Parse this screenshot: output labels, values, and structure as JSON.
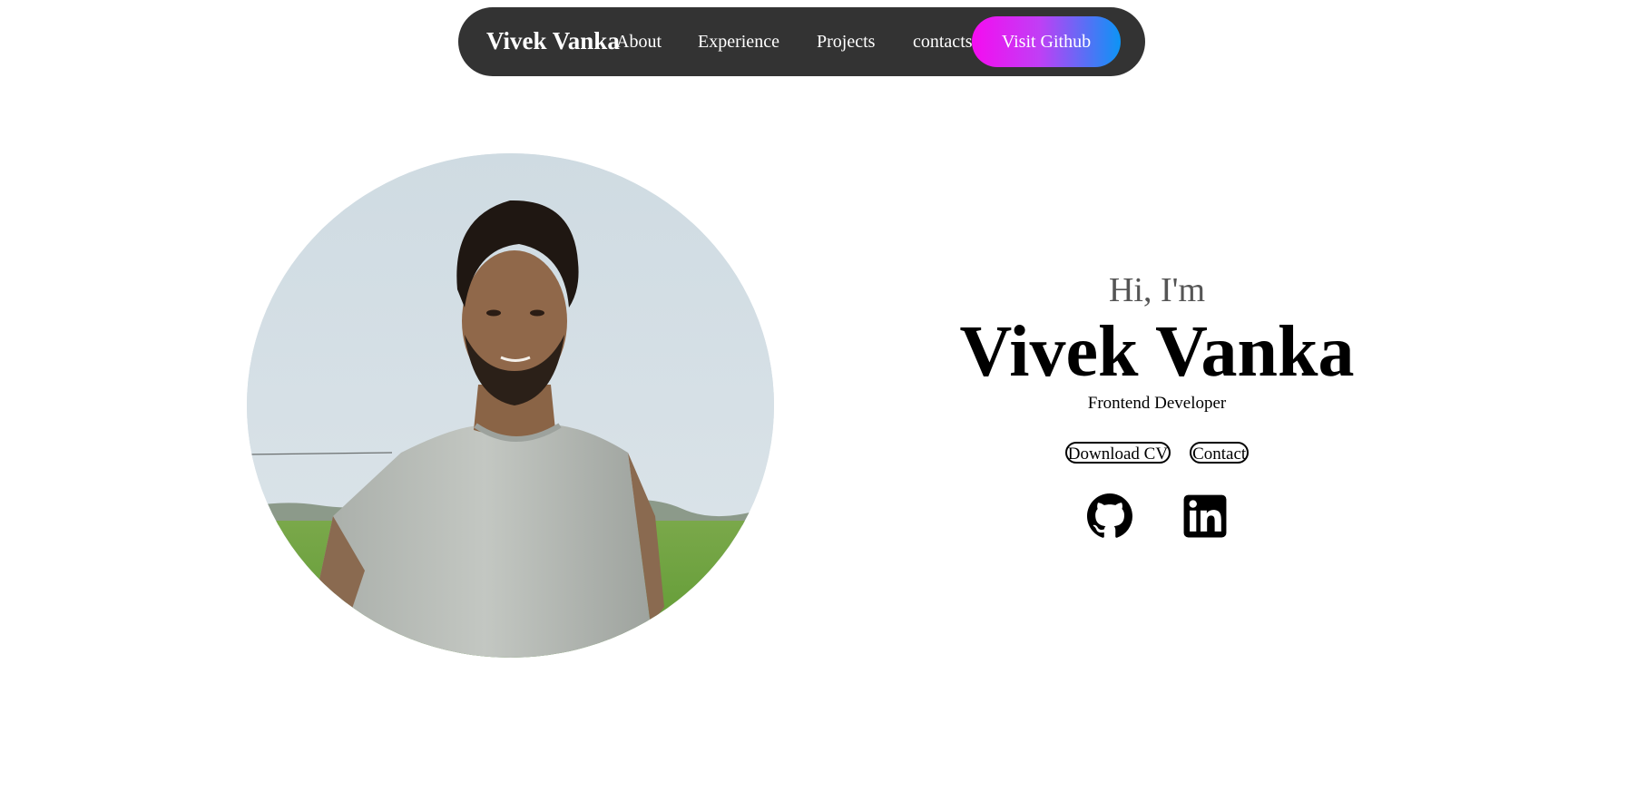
{
  "nav": {
    "brand": "Vivek Vanka",
    "links": [
      "About",
      "Experience",
      "Projects",
      "contacts"
    ],
    "cta_label": "Visit Github",
    "background": "#333333",
    "cta_gradient": [
      "#f50cf0",
      "#0c94f5"
    ]
  },
  "hero": {
    "greeting": "Hi, I'm",
    "name": "Vivek Vanka",
    "role": "Frontend Developer",
    "buttons": {
      "download_cv": "Download CV",
      "contact": "Contact"
    },
    "socials": [
      {
        "icon": "github-icon"
      },
      {
        "icon": "linkedin-icon"
      }
    ],
    "photo": "profile-photo"
  }
}
